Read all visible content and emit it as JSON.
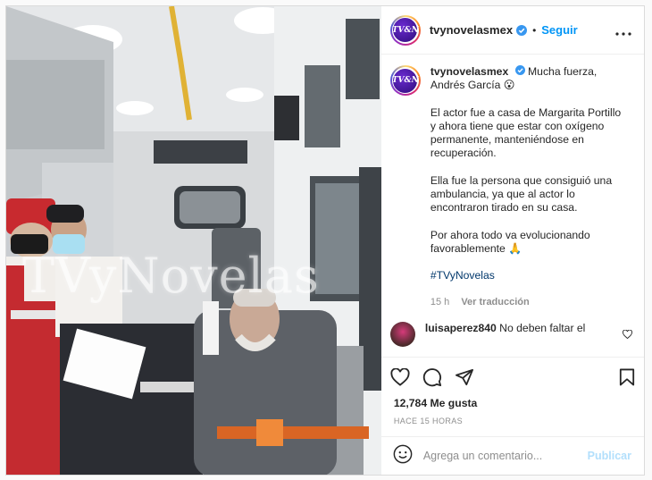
{
  "post": {
    "username": "tvynovelasmex",
    "avatar_text": "TV&N",
    "follow_label": "Seguir",
    "separator": "•",
    "more_icon": "more-horizontal-icon",
    "verified_icon": "verified-badge-icon",
    "watermark": "TVyNovelas",
    "caption": {
      "title": "Mucha fuerza, Andrés García 😮",
      "paragraphs": [
        "El actor fue a casa de Margarita Portillo y ahora tiene que estar con oxígeno permanente, manteniéndose en recuperación.",
        "Ella fue la persona que consiguió una ambulancia, ya que al actor lo encontraron tirado en su casa.",
        "Por ahora todo va evolucionando favorablemente 🙏"
      ],
      "hashtag": "#TVyNovelas",
      "age": "15 h",
      "translate": "Ver traducción"
    },
    "comment": {
      "username": "luisaperez840",
      "text": "No deben faltar el"
    },
    "actions": {
      "like_icon": "heart-icon",
      "comment_icon": "comment-icon",
      "share_icon": "share-icon",
      "save_icon": "bookmark-icon"
    },
    "likes": "12,784 Me gusta",
    "timestamp": "HACE 15 HORAS",
    "add_comment": {
      "placeholder": "Agrega un comentario...",
      "emoji_icon": "emoji-icon",
      "publish_label": "Publicar"
    },
    "colors": {
      "accent": "#0095f6",
      "publish_disabled": "#b2dffc",
      "hashtag": "#00376b",
      "muted": "#8e8e8e"
    }
  }
}
